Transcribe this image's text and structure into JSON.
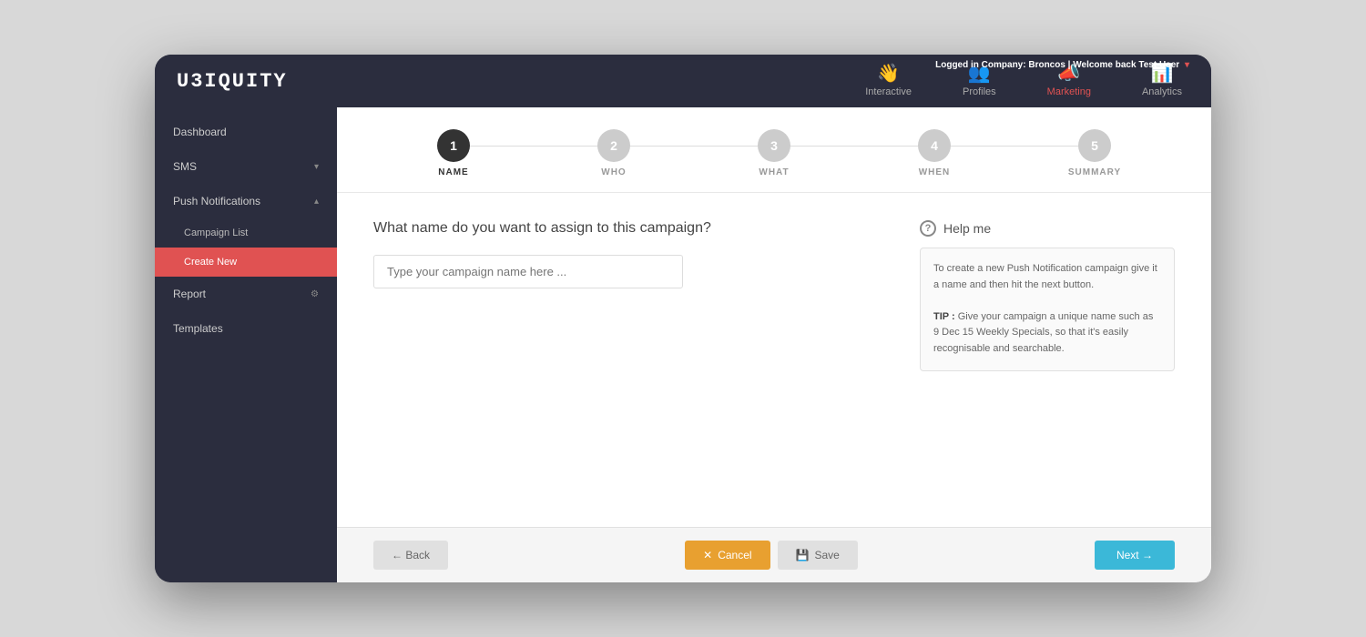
{
  "header": {
    "logo": "U3IQUITY",
    "user_info": "Logged in Company: Broncos | Welcome back",
    "user_name": "Test User",
    "nav": [
      {
        "id": "interactive",
        "label": "Interactive",
        "icon": "👋",
        "active": false
      },
      {
        "id": "profiles",
        "label": "Profiles",
        "icon": "👥",
        "active": false
      },
      {
        "id": "marketing",
        "label": "Marketing",
        "icon": "📣",
        "active": true
      },
      {
        "id": "analytics",
        "label": "Analytics",
        "icon": "📊",
        "active": false
      }
    ]
  },
  "sidebar": {
    "items": [
      {
        "id": "dashboard",
        "label": "Dashboard",
        "has_chevron": false,
        "indent": false,
        "active": false
      },
      {
        "id": "sms",
        "label": "SMS",
        "has_chevron": true,
        "indent": false,
        "active": false
      },
      {
        "id": "push-notifications",
        "label": "Push Notifications",
        "has_chevron": true,
        "indent": false,
        "active": false
      },
      {
        "id": "campaign-list",
        "label": "Campaign List",
        "has_chevron": false,
        "indent": true,
        "active": false
      },
      {
        "id": "create-new",
        "label": "Create New",
        "has_chevron": false,
        "indent": true,
        "active": true
      },
      {
        "id": "report",
        "label": "Report",
        "has_chevron": false,
        "indent": false,
        "active": false,
        "has_icon": true
      },
      {
        "id": "templates",
        "label": "Templates",
        "has_chevron": false,
        "indent": false,
        "active": false
      }
    ]
  },
  "wizard": {
    "steps": [
      {
        "number": "1",
        "label": "NAME",
        "active": true
      },
      {
        "number": "2",
        "label": "WHO",
        "active": false
      },
      {
        "number": "3",
        "label": "WHAT",
        "active": false
      },
      {
        "number": "4",
        "label": "WHEN",
        "active": false
      },
      {
        "number": "5",
        "label": "SUMMARY",
        "active": false
      }
    ],
    "form": {
      "question": "What name do you want to assign to this campaign?",
      "input_placeholder": "Type your campaign name here ...",
      "input_value": ""
    },
    "help": {
      "header": "Help me",
      "body_line1": "To create a new Push Notification campaign give it a name and then hit the next button.",
      "tip_label": "TIP :",
      "tip_text": " Give your campaign a unique name such as 9 Dec 15 Weekly Specials, so that it's easily recognisable and searchable."
    },
    "buttons": {
      "back": "← Back",
      "cancel": "Cancel",
      "save": "Save",
      "next": "Next →"
    }
  }
}
